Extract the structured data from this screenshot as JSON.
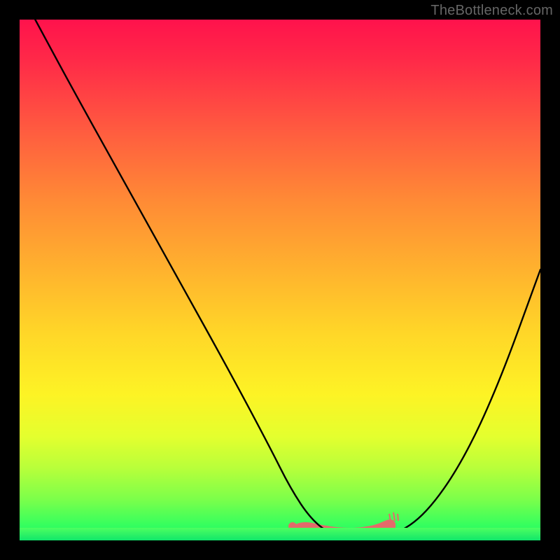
{
  "watermark": "TheBottleneck.com",
  "chart_data": {
    "type": "line",
    "title": "",
    "xlabel": "",
    "ylabel": "",
    "xlim": [
      0,
      100
    ],
    "ylim": [
      0,
      100
    ],
    "grid": false,
    "series": [
      {
        "name": "curve",
        "color": "#000000",
        "x": [
          3,
          10,
          20,
          30,
          40,
          48,
          52,
          56,
          60,
          64,
          68,
          72,
          78,
          85,
          92,
          100
        ],
        "values": [
          100,
          87,
          69,
          51,
          33,
          18,
          10,
          4,
          1,
          0.5,
          0.5,
          1,
          5,
          15,
          30,
          52
        ]
      }
    ],
    "annotations": [
      {
        "name": "bottom-band",
        "y": 0,
        "color_start": "#4dff60",
        "color_end": "#10e66a"
      },
      {
        "name": "valley-blob",
        "color": "#e46a6a",
        "x_range": [
          52,
          72
        ],
        "y": 1.2
      }
    ],
    "background_gradient": {
      "orientation": "vertical",
      "stops": [
        {
          "pos": 0,
          "color": "#ff124c"
        },
        {
          "pos": 22,
          "color": "#ff5e3f"
        },
        {
          "pos": 48,
          "color": "#ffb22e"
        },
        {
          "pos": 72,
          "color": "#fdf325"
        },
        {
          "pos": 92,
          "color": "#7dff4a"
        },
        {
          "pos": 100,
          "color": "#17f26a"
        }
      ]
    }
  }
}
